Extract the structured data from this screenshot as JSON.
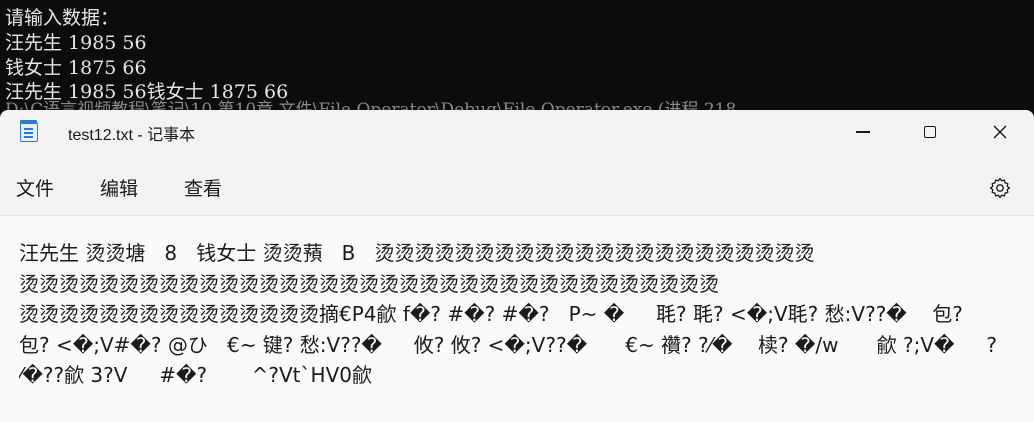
{
  "console": {
    "lines": [
      "请输入数据：",
      "汪先生 1985 56",
      "钱女士 1875 66",
      "汪先生 1985 56钱女士 1875 66",
      "D:\\C语言视频教程\\笔记\\10.第10章 文件\\File Operator\\Debug\\File Operator.exe (进程 218"
    ]
  },
  "notepad": {
    "title": "test12.txt - 记事本",
    "menu": {
      "file": "文件",
      "edit": "编辑",
      "view": "查看"
    },
    "content_lines": [
      "汪先生 烫烫塘   8   钱女士 烫烫蕷   B   烫烫烫烫烫烫烫烫烫烫烫烫烫烫烫烫烫烫烫烫烫烫",
      "烫烫烫烫烫烫烫烫烫烫烫烫烫烫烫烫烫烫烫烫烫烫烫烫烫烫烫烫烫烫烫烫烫烫烫",
      "烫烫烫烫烫烫烫烫烫烫烫烫烫烫烫摘€P4歈 f�? #�? #�?   P~ �     毦? 毦? <�;V毦? 愁:V??�    包?",
      "包? <�;V#�? @ひ   €~ 键? 愁:V??�     攸? 攸? <�;V??�      €~ 禶? ?⁄�    椟? �/w      歈 ?;V�     ?",
      "⁄�??歈 3?V     #�?       ^?Vt`HV0歈"
    ]
  },
  "icons": {
    "app": "notepad-icon",
    "minimize": "minimize-icon",
    "maximize": "maximize-icon",
    "close": "close-icon",
    "settings": "gear-icon"
  }
}
